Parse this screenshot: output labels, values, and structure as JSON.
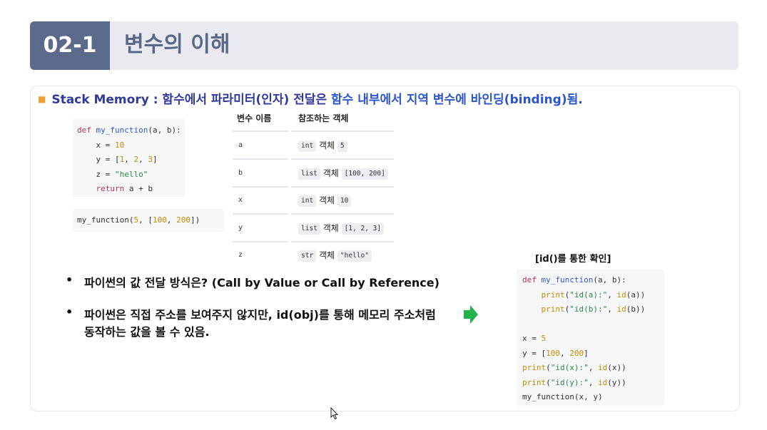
{
  "header": {
    "number": "02-1",
    "title": "변수의 이해"
  },
  "main_bullet": {
    "label": "Stack Memory : 함수에서 파라미터(인자) 전달은 ",
    "highlight": "함수 내부에서 지역 변수에 바인딩(binding)됨."
  },
  "code_def": {
    "line1_kw": "def",
    "line1_fn": "my_function",
    "line1_rest": "(a, b):",
    "line2_pre": "    x = ",
    "line2_num": "10",
    "line3_pre": "    y = [",
    "line3_n1": "1",
    "line3_c1": ", ",
    "line3_n2": "2",
    "line3_c2": ", ",
    "line3_n3": "3",
    "line3_post": "]",
    "line4_pre": "    z = ",
    "line4_str": "\"hello\"",
    "line5_kw": "    return",
    "line5_rest": " a + b"
  },
  "code_call": {
    "pre": "my_function(",
    "n1": "5",
    "mid": ", [",
    "n2": "100",
    "c": ", ",
    "n3": "200",
    "post": "])"
  },
  "table": {
    "headers": [
      "변수 이름",
      "참조하는 객체"
    ],
    "rows": [
      {
        "var": "a",
        "type": "int",
        "obj": "객체",
        "val": "5"
      },
      {
        "var": "b",
        "type": "list",
        "obj": "객체",
        "val": "[100, 200]"
      },
      {
        "var": "x",
        "type": "int",
        "obj": "객체",
        "val": "10"
      },
      {
        "var": "y",
        "type": "list",
        "obj": "객체",
        "val": "[1, 2, 3]"
      },
      {
        "var": "z",
        "type": "str",
        "obj": "객체",
        "val": "\"hello\""
      }
    ]
  },
  "bullets": [
    {
      "dot": "•",
      "text": "파이썬의 값 전달 방식은? (Call by Value or Call by Reference)"
    },
    {
      "dot": "•",
      "text": "파이썬은 직접 주소를 보여주지 않지만, id(obj)를 통해 메모리 주소처럼",
      "text2": "동작하는 값을 볼 수 있음."
    }
  ],
  "right": {
    "title": "[id()를 통한 확인]",
    "l1_kw": "def",
    "l1_fn": "my_function",
    "l1_rest": "(a, b):",
    "l2_fn": "    print",
    "l2_a": "(",
    "l2_str": "\"id(a):\"",
    "l2_b": ", ",
    "l2_fn2": "id",
    "l2_c": "(a))",
    "l3_fn": "    print",
    "l3_a": "(",
    "l3_str": "\"id(b):\"",
    "l3_b": ", ",
    "l3_fn2": "id",
    "l3_c": "(b))",
    "l5_pre": "x = ",
    "l5_num": "5",
    "l6_pre": "y = [",
    "l6_n1": "100",
    "l6_c": ", ",
    "l6_n2": "200",
    "l6_post": "]",
    "l7_fn": "print",
    "l7_a": "(",
    "l7_str": "\"id(x):\"",
    "l7_b": ", ",
    "l7_fn2": "id",
    "l7_c": "(x))",
    "l8_fn": "print",
    "l8_a": "(",
    "l8_str": "\"id(y):\"",
    "l8_b": ", ",
    "l8_fn2": "id",
    "l8_c": "(y))",
    "l9": "my_function(x, y)"
  },
  "colors": {
    "accent": "#5b6a8a",
    "title": "#5a6888",
    "bullet_sq": "#f0a030",
    "arrow": "#22b14c"
  },
  "icons": {
    "arrow": "right-arrow-icon",
    "cursor": "mouse-pointer-icon"
  }
}
